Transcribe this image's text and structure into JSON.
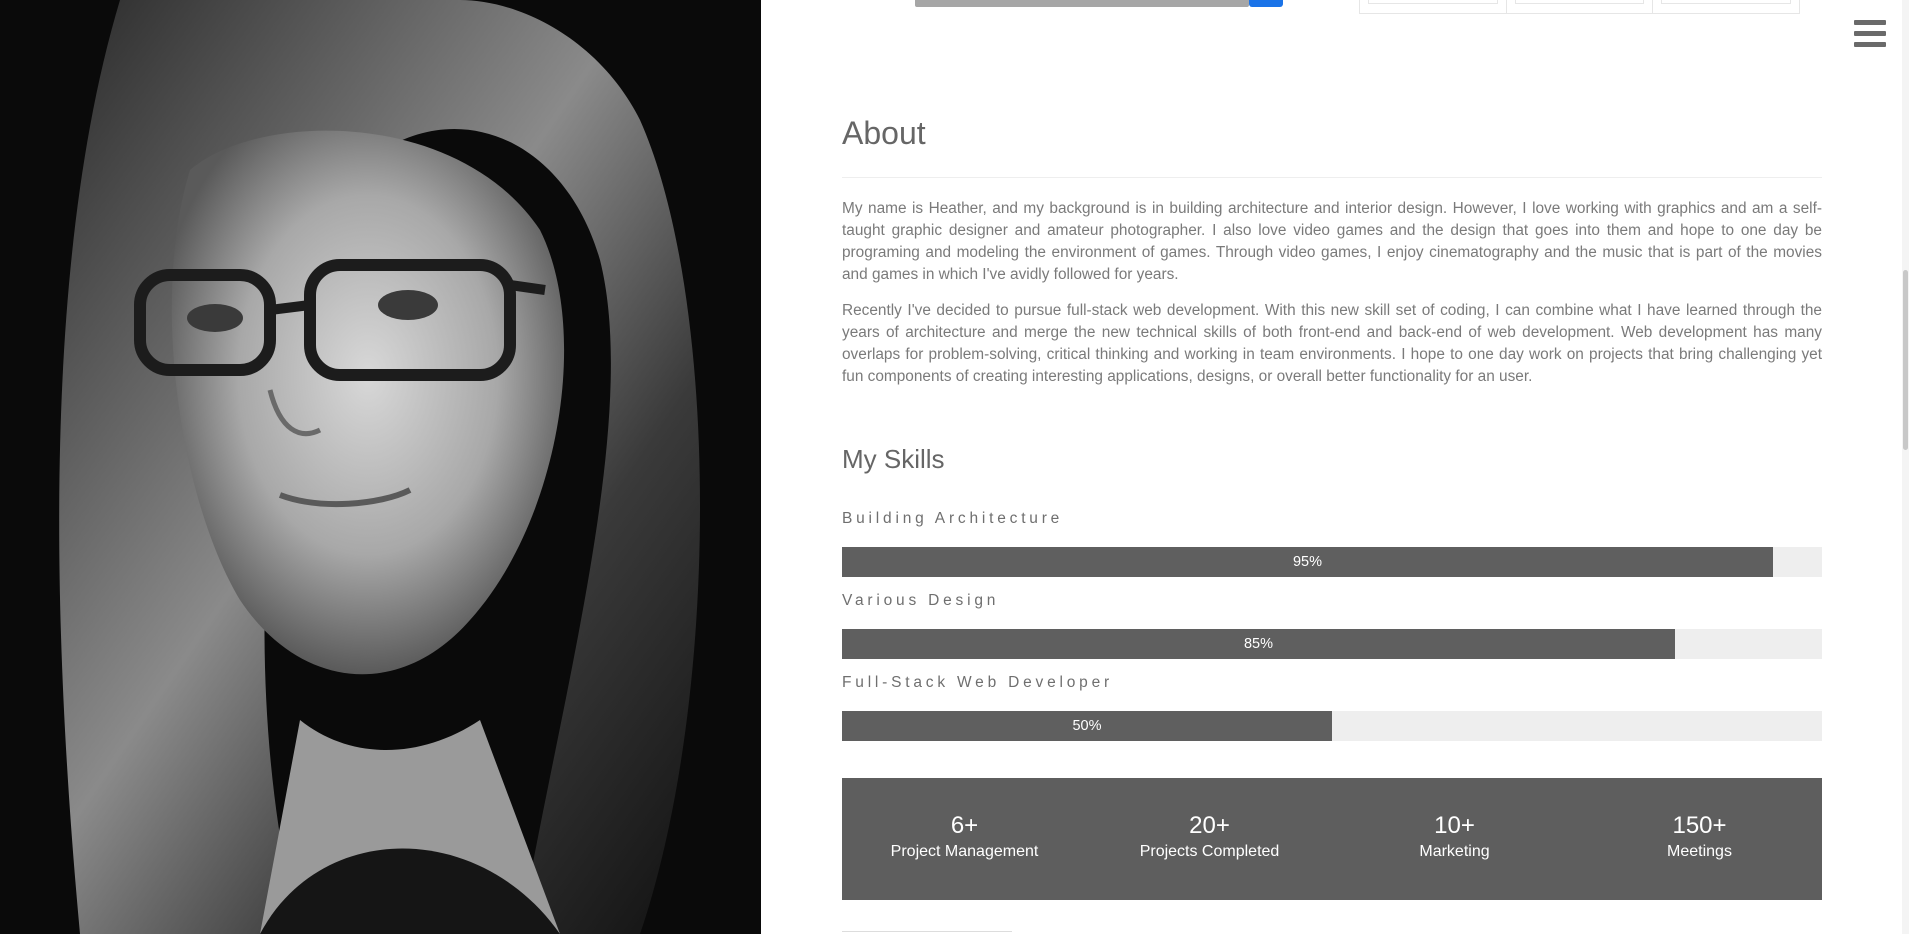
{
  "photo": {
    "icon": "portrait-photo",
    "caption": ""
  },
  "header": {
    "menu_icon": "hamburger-menu-icon"
  },
  "about": {
    "title": "About",
    "paragraph_1": "My name is Heather, and my background is in building architecture and interior design. However, I love working with graphics and am a self-taught graphic designer and amateur photographer. I also love video games and the design that goes into them and hope to one day be programing and modeling the environment of games. Through video games, I enjoy cinematography and the music that is part of the movies and games in which I've avidly followed for years.",
    "paragraph_2": "Recently I've decided to pursue full-stack web development. With this new skill set of coding, I can combine what I have learned through the years of architecture and merge the new technical skills of both front-end and back-end of web development. Web development has many overlaps for problem-solving, critical thinking and working in team environments. I hope to one day work on projects that bring challenging yet fun components of creating interesting applications, designs, or overall better functionality for an user."
  },
  "skills": {
    "title": "My Skills",
    "items": [
      {
        "label": "Building Architecture",
        "percent": 95,
        "percent_text": "95%"
      },
      {
        "label": "Various Design",
        "percent": 85,
        "percent_text": "85%"
      },
      {
        "label": "Full-Stack Web Developer",
        "percent": 50,
        "percent_text": "50%"
      }
    ]
  },
  "stats": [
    {
      "number": "6+",
      "label": "Project Management"
    },
    {
      "number": "20+",
      "label": "Projects Completed"
    },
    {
      "number": "10+",
      "label": "Marketing"
    },
    {
      "number": "150+",
      "label": "Meetings"
    }
  ],
  "colors": {
    "bar_fill": "#5f5f5f",
    "bar_track": "#eeeeee",
    "stats_bg": "#5e5e5e",
    "accent_button": "#1a73e8"
  }
}
